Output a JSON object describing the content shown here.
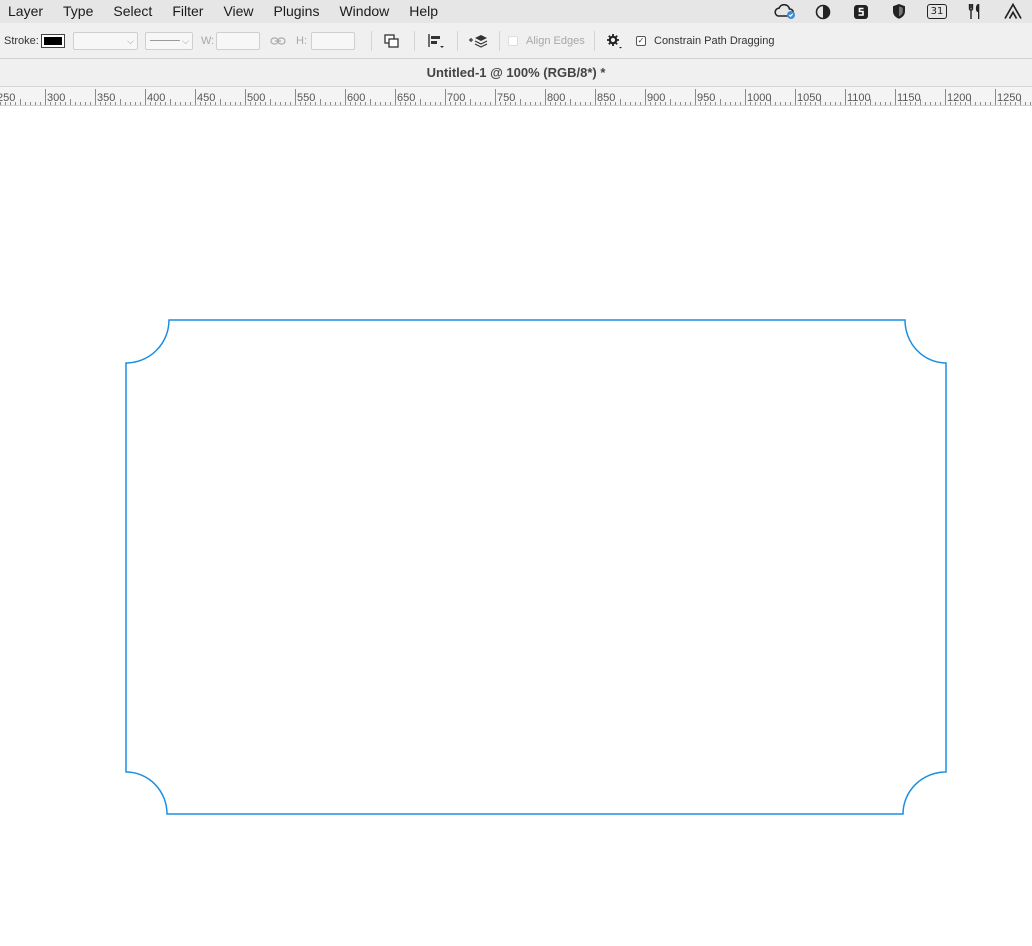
{
  "menubar": {
    "items": [
      "Layer",
      "Type",
      "Select",
      "Filter",
      "View",
      "Plugins",
      "Window",
      "Help"
    ],
    "tray_icons": [
      "creative-cloud-sync-icon",
      "contrast-icon",
      "shortcut-app-icon",
      "shield-icon",
      "calendar-icon",
      "utensils-icon",
      "adobe-icon"
    ],
    "calendar_day": "31"
  },
  "options": {
    "stroke_label": "Stroke:",
    "width_label": "W:",
    "height_label": "H:",
    "align_edges_label": "Align Edges",
    "align_edges_checked": false,
    "constrain_label": "Constrain Path Dragging",
    "constrain_checked": true,
    "check_glyph": "✓",
    "chevron_glyph": "⌵"
  },
  "document": {
    "title": "Untitled-1 @ 100% (RGB/8*) *"
  },
  "ruler": {
    "labels": [
      "250",
      "300",
      "350",
      "400",
      "450",
      "500",
      "550",
      "600",
      "650",
      "700",
      "750",
      "800",
      "850",
      "900",
      "950",
      "1000",
      "1050",
      "1100",
      "1150",
      "1200",
      "1250"
    ]
  },
  "shape": {
    "type": "ticket-rectangle-inverted-round-corners",
    "stroke_color": "#1a8fe3"
  }
}
